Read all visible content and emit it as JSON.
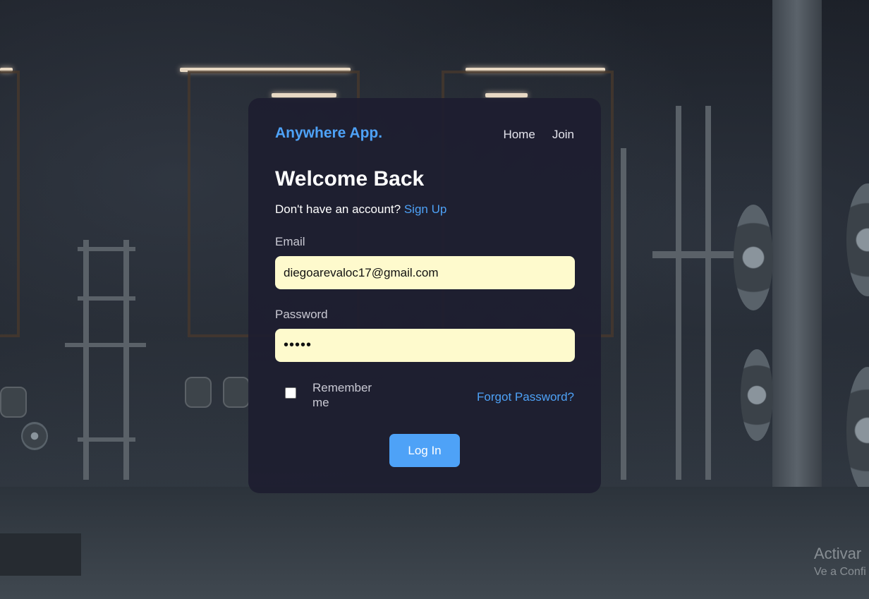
{
  "brand": "Anywhere App.",
  "nav": {
    "home": "Home",
    "join": "Join"
  },
  "heading": "Welcome Back",
  "signup_prompt": {
    "text": "Don't have an account?",
    "link": "Sign Up"
  },
  "form": {
    "email_label": "Email",
    "email_value": "diegoarevaloc17@gmail.com",
    "password_label": "Password",
    "password_value": "•••••",
    "remember_label": "Remember me",
    "remember_checked": false,
    "forgot_label": "Forgot Password?",
    "submit_label": "Log In"
  },
  "watermark": {
    "line1": "Activar",
    "line2": "Ve a Confi"
  },
  "colors": {
    "accent": "#4ea2f7",
    "card_bg": "#1e1e30",
    "input_bg": "#fefacd"
  }
}
